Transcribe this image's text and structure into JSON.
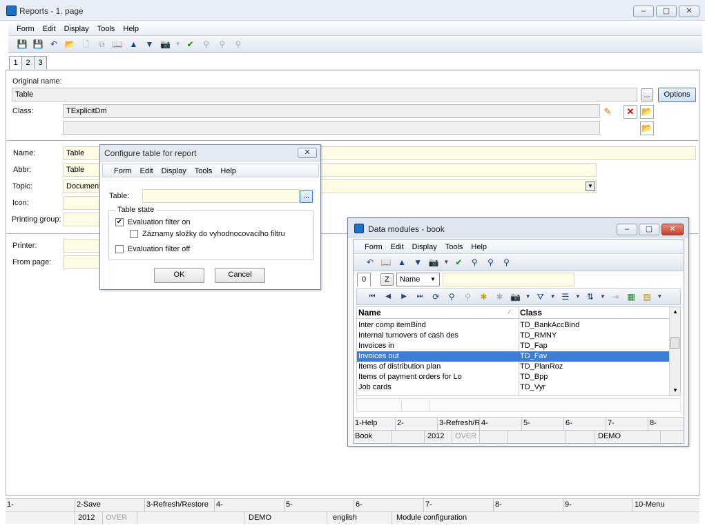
{
  "window": {
    "title": "Reports - 1. page"
  },
  "menu": [
    "Form",
    "Edit",
    "Display",
    "Tools",
    "Help"
  ],
  "tabs": [
    "1",
    "2",
    "3"
  ],
  "form": {
    "original_name_label": "Original name:",
    "original_name_value": "Table",
    "ellipsis_label": "...",
    "options_label": "Options",
    "class_label": "Class:",
    "class_value": "TExplicitDm",
    "name_label": "Name:",
    "name_value": "Table",
    "abbr_label": "Abbr:",
    "abbr_value": "Table",
    "topic_label": "Topic:",
    "topic_value": "Document",
    "icon_label": "Icon:",
    "printing_group_label": "Printing group:",
    "printer_label": "Printer:",
    "from_page_label": "From page:"
  },
  "status_fkeys": [
    "1-",
    "2-Save",
    "3-Refresh/Restore",
    "4-",
    "5-",
    "6-",
    "7-",
    "8-",
    "9-",
    "10-Menu"
  ],
  "status_info": {
    "year": "2012",
    "over": "OVER",
    "db": "DEMO",
    "language": "english",
    "module": "Module configuration"
  },
  "configure_dialog": {
    "title": "Configure table for report",
    "close_label": "✕",
    "menu": [
      "Form",
      "Edit",
      "Display",
      "Tools",
      "Help"
    ],
    "table_label": "Table:",
    "table_value": "",
    "ellipsis_label": "...",
    "group_label": "Table state",
    "opt1_label": "Evaluation filter on",
    "opt1_checked": true,
    "opt2_label": "Záznamy složky do vyhodnocovacího filtru",
    "opt2_checked": false,
    "opt3_label": "Evaluation filter off",
    "opt3_checked": false,
    "ok_label": "OK",
    "cancel_label": "Cancel"
  },
  "data_modules": {
    "title": "Data modules - book",
    "menu": [
      "Form",
      "Edit",
      "Display",
      "Tools",
      "Help"
    ],
    "tab": "0",
    "z_label": "Z",
    "sort_value": "Name",
    "columns": {
      "name": "Name",
      "class": "Class"
    },
    "rows": [
      {
        "name": "Inter comp itemBind",
        "class": "TD_BankAccBind",
        "selected": false
      },
      {
        "name": "Internal turnovers of cash des",
        "class": "TD_RMNY",
        "selected": false
      },
      {
        "name": "Invoices in",
        "class": "TD_Fap",
        "selected": false
      },
      {
        "name": "Invoices out",
        "class": "TD_Fav",
        "selected": true
      },
      {
        "name": "Items of distribution plan",
        "class": "TD_PlanRoz",
        "selected": false
      },
      {
        "name": "Items of payment orders for Lo",
        "class": "TD_Bpp",
        "selected": false
      },
      {
        "name": "Job cards",
        "class": "TD_Vyr",
        "selected": false
      }
    ],
    "fkeys": [
      "1-Help",
      "2-",
      "3-Refresh/R",
      "4-",
      "5-",
      "6-",
      "7-",
      "8-"
    ],
    "status": {
      "book": "Book",
      "year": "2012",
      "over": "OVER",
      "db": "DEMO"
    }
  },
  "colors": {
    "selection": "#3b7ed6",
    "field_yellow": "#fffde6",
    "accent": "#1f6fc4"
  }
}
